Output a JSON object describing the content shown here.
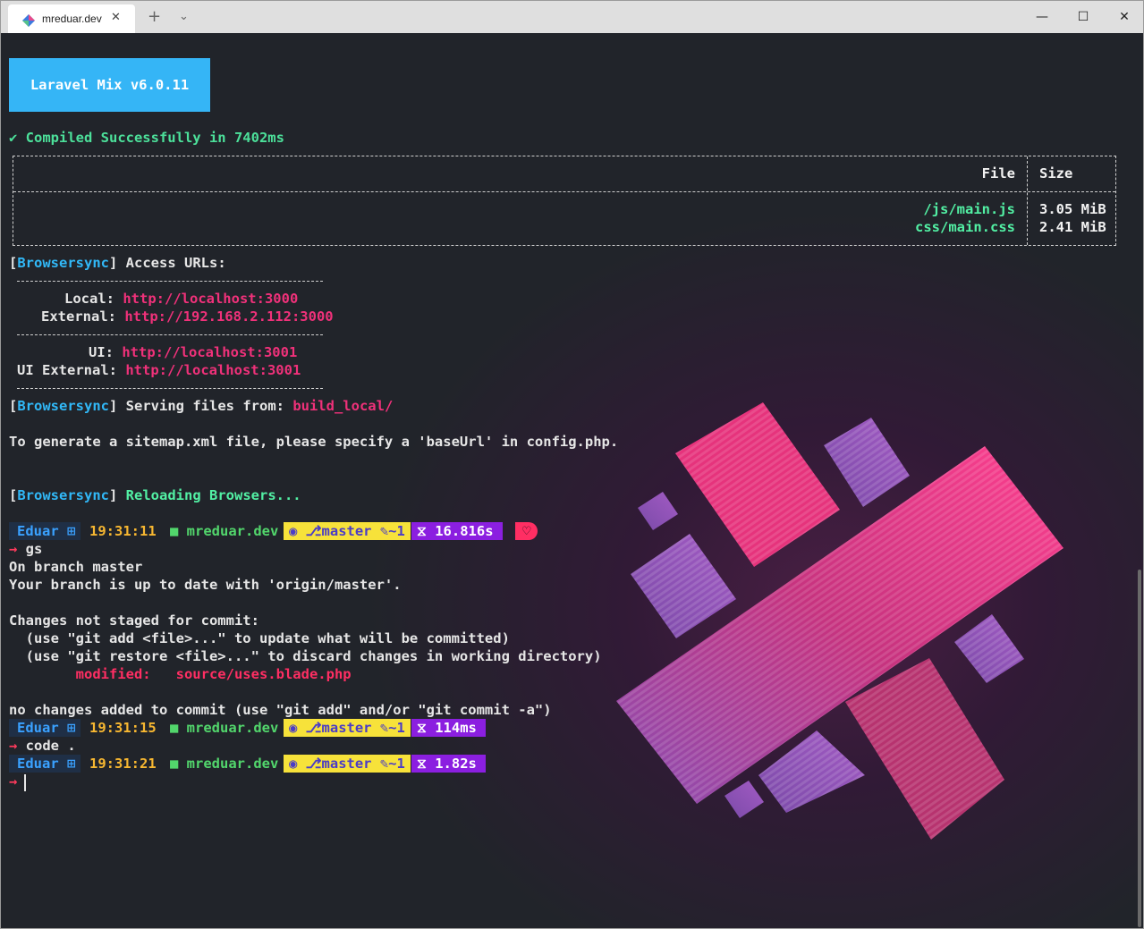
{
  "window": {
    "tab_title": "mreduar.dev",
    "tab_close_icon": "close-icon",
    "new_tab_label": "+",
    "dropdown_label": "⌄",
    "minimize_label": "—",
    "maximize_label": "☐",
    "close_label": "✕"
  },
  "mix": {
    "badge": "Laravel Mix v6.0.11",
    "compiled": "✔ Compiled Successfully in 7402ms",
    "table": {
      "headers": {
        "file": "File",
        "size": "Size"
      },
      "rows": [
        {
          "file": "/js/main.js",
          "size": "3.05 MiB"
        },
        {
          "file": "css/main.css",
          "size": "2.41 MiB"
        }
      ]
    }
  },
  "browsersync": {
    "tag_open": "[",
    "tag": "Browsersync",
    "tag_close": "]",
    "access_urls": " Access URLs:",
    "local_label": "Local: ",
    "local_url": "http://localhost:3000",
    "external_label": "External: ",
    "external_url": "http://192.168.2.112:3000",
    "ui_label": "UI: ",
    "ui_url": "http://localhost:3001",
    "ui_external_label": "UI External: ",
    "ui_external_url": "http://localhost:3001",
    "serving_label": " Serving files from: ",
    "serving_path": "build_local/",
    "sitemap_note": "To generate a sitemap.xml file, please specify a 'baseUrl' in config.php.",
    "reloading": " Reloading Browsers..."
  },
  "prompts": [
    {
      "user": "Eduar ⊞",
      "time": "19:31:11",
      "dir": "■ mreduar.dev",
      "git": "◉ ⎇master ✎~1",
      "duration": "⧖ 16.816s",
      "heart": "♡"
    },
    {
      "user": "Eduar ⊞",
      "time": "19:31:15",
      "dir": "■ mreduar.dev",
      "git": "◉ ⎇master ✎~1",
      "duration": "⧖ 114ms"
    },
    {
      "user": "Eduar ⊞",
      "time": "19:31:21",
      "dir": "■ mreduar.dev",
      "git": "◉ ⎇master ✎~1",
      "duration": "⧖ 1.82s"
    }
  ],
  "git_output": {
    "caret": "→",
    "cmd1": " gs",
    "on_branch": "On branch master",
    "up_to_date": "Your branch is up to date with 'origin/master'.",
    "not_staged": "Changes not staged for commit:",
    "hint_add": "  (use \"git add <file>...\" to update what will be committed)",
    "hint_restore": "  (use \"git restore <file>...\" to discard changes in working directory)",
    "modified_label": "        modified:   ",
    "modified_file": "source/uses.blade.php",
    "no_changes": "no changes added to commit (use \"git add\" and/or \"git commit -a\")",
    "cmd2": " code ."
  },
  "colors": {
    "terminal_bg": "#21242a",
    "mix_badge": "#35b5f6",
    "success_green": "#52f0a4",
    "browsersync_blue": "#31b8f7",
    "url_red": "#f0317a",
    "git_yellow": "#f7e23a",
    "duration_purple": "#8b1fe0",
    "heart_pink": "#ff2e63"
  }
}
